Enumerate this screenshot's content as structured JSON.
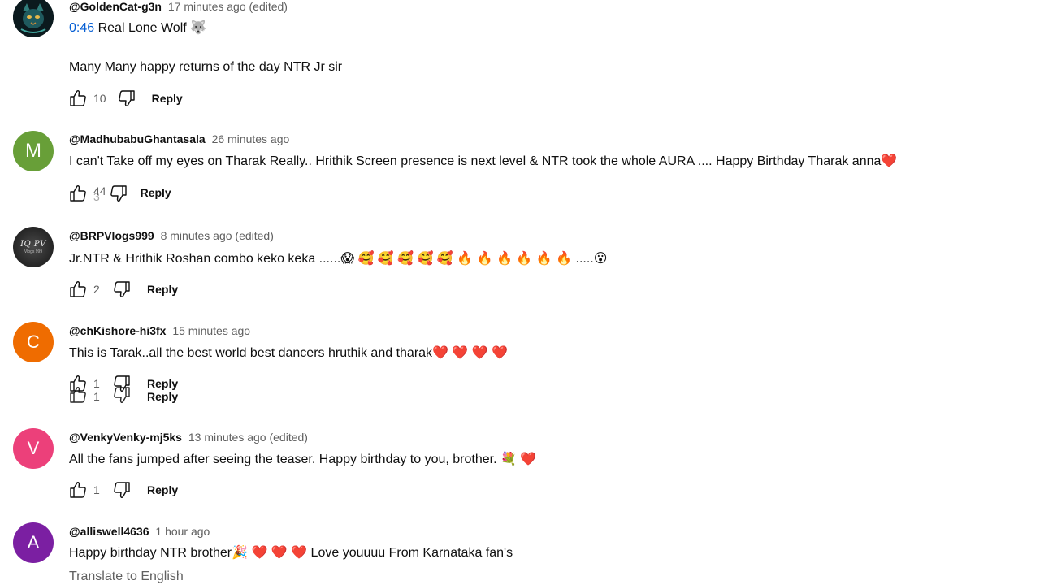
{
  "comments": [
    {
      "author": "@GoldenCat-g3n",
      "meta": "17 minutes ago (edited)",
      "timestamp": "0:46",
      "line1": "Real Lone Wolf 🐺",
      "line2": "Many Many happy returns of the day NTR Jr sir",
      "likes": "10",
      "reply": "Reply"
    },
    {
      "author": "@MadhubabuGhantasala",
      "meta": "26 minutes ago",
      "avatar_letter": "M",
      "avatar_color": "#689f38",
      "text": "I can't Take off my eyes on Tharak Really.. Hrithik Screen presence is next level & NTR took the whole AURA .... Happy Birthday Tharak anna❤️",
      "likes": "44",
      "likes_ghost": "3",
      "reply": "Reply"
    },
    {
      "author": "@BRPVlogs999",
      "meta": "8 minutes ago (edited)",
      "avatar_logo": "IQ PV",
      "avatar_logo_sub": "Vlogs 999",
      "text": "Jr.NTR & Hrithik Roshan combo keko keka ......😱 🥰 🥰 🥰 🥰 🥰 🔥 🔥 🔥 🔥 🔥 🔥 .....😮",
      "likes": "2",
      "reply": "Reply"
    },
    {
      "author": "@chKishore-hi3fx",
      "meta": "15 minutes ago",
      "avatar_letter": "C",
      "avatar_color": "#ef6c00",
      "text": "This is Tarak..all the best world best dancers hruthik and tharak❤️ ❤️ ❤️ ❤️",
      "likes": "1",
      "reply": "Reply"
    },
    {
      "author": "@VenkyVenky-mj5ks",
      "meta": "13 minutes ago (edited)",
      "avatar_letter": "V",
      "avatar_color": "#ec407a",
      "text": "All the fans jumped after seeing the teaser. Happy birthday to you, brother. 💐 ❤️",
      "likes": "1",
      "reply": "Reply"
    },
    {
      "author": "@alliswell4636",
      "meta": "1 hour ago",
      "avatar_letter": "A",
      "avatar_color": "#7b1fa2",
      "text": "Happy birthday NTR brother🎉 ❤️ ❤️ ❤️ Love youuuu From Karnataka fan's",
      "translate": "Translate to English"
    }
  ],
  "colors": {
    "timestamp_link": "#065fd4",
    "meta_gray": "#606060",
    "text": "#0f0f0f"
  }
}
